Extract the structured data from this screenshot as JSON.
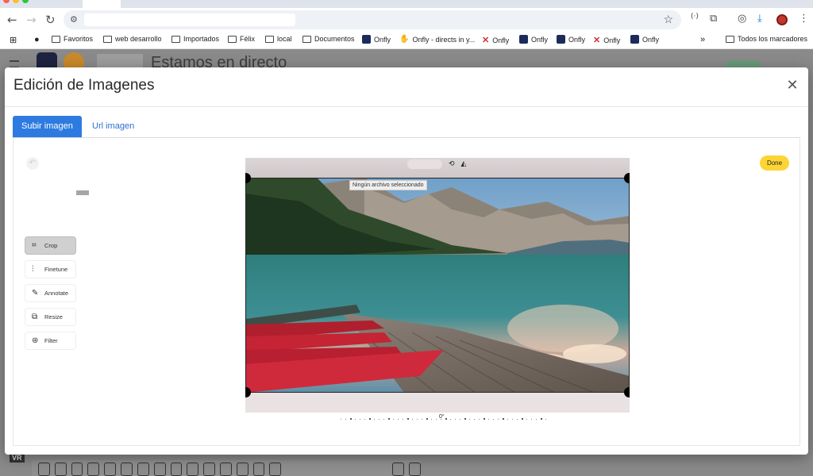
{
  "bookmarks": {
    "items": [
      {
        "label": "Favoritos",
        "icon": "folder-icon"
      },
      {
        "label": "web desarrollo",
        "icon": "folder-icon"
      },
      {
        "label": "Importados",
        "icon": "folder-icon"
      },
      {
        "label": "Félix",
        "icon": "folder-icon"
      },
      {
        "label": "local",
        "icon": "folder-icon"
      },
      {
        "label": "Documentos",
        "icon": "folder-icon"
      },
      {
        "label": "Onfly",
        "icon": "onfly-icon"
      },
      {
        "label": "Onfly - directs in y...",
        "icon": "hand-icon"
      },
      {
        "label": "Onfly",
        "icon": "x-icon"
      },
      {
        "label": "Onfly",
        "icon": "onfly-icon"
      },
      {
        "label": "Onfly",
        "icon": "onfly-icon"
      },
      {
        "label": "Onfly",
        "icon": "x-icon"
      },
      {
        "label": "Onfly",
        "icon": "onfly-icon"
      }
    ],
    "overflow_label": "»",
    "all_bookmarks_label": "Todos los marcadores"
  },
  "background": {
    "title": "Estamos en directo",
    "badge": "VR"
  },
  "modal": {
    "title": "Edición de Imagenes",
    "close_glyph": "✕",
    "tabs": [
      {
        "label": "Subir imagen",
        "active": true
      },
      {
        "label": "Url imagen",
        "active": false
      }
    ]
  },
  "editor": {
    "done_label": "Done",
    "tooltip": "Ningún archivo seleccionado",
    "tools": [
      {
        "label": "Crop",
        "icon": "crop-icon",
        "active": true
      },
      {
        "label": "Finetune",
        "icon": "sliders-icon",
        "active": false
      },
      {
        "label": "Annotate",
        "icon": "pencil-icon",
        "active": false
      },
      {
        "label": "Resize",
        "icon": "resize-icon",
        "active": false
      },
      {
        "label": "Filter",
        "icon": "filter-icon",
        "active": false
      }
    ],
    "rotation_label": "0°"
  },
  "colors": {
    "accent": "#2d7be0",
    "done": "#fcd534"
  }
}
